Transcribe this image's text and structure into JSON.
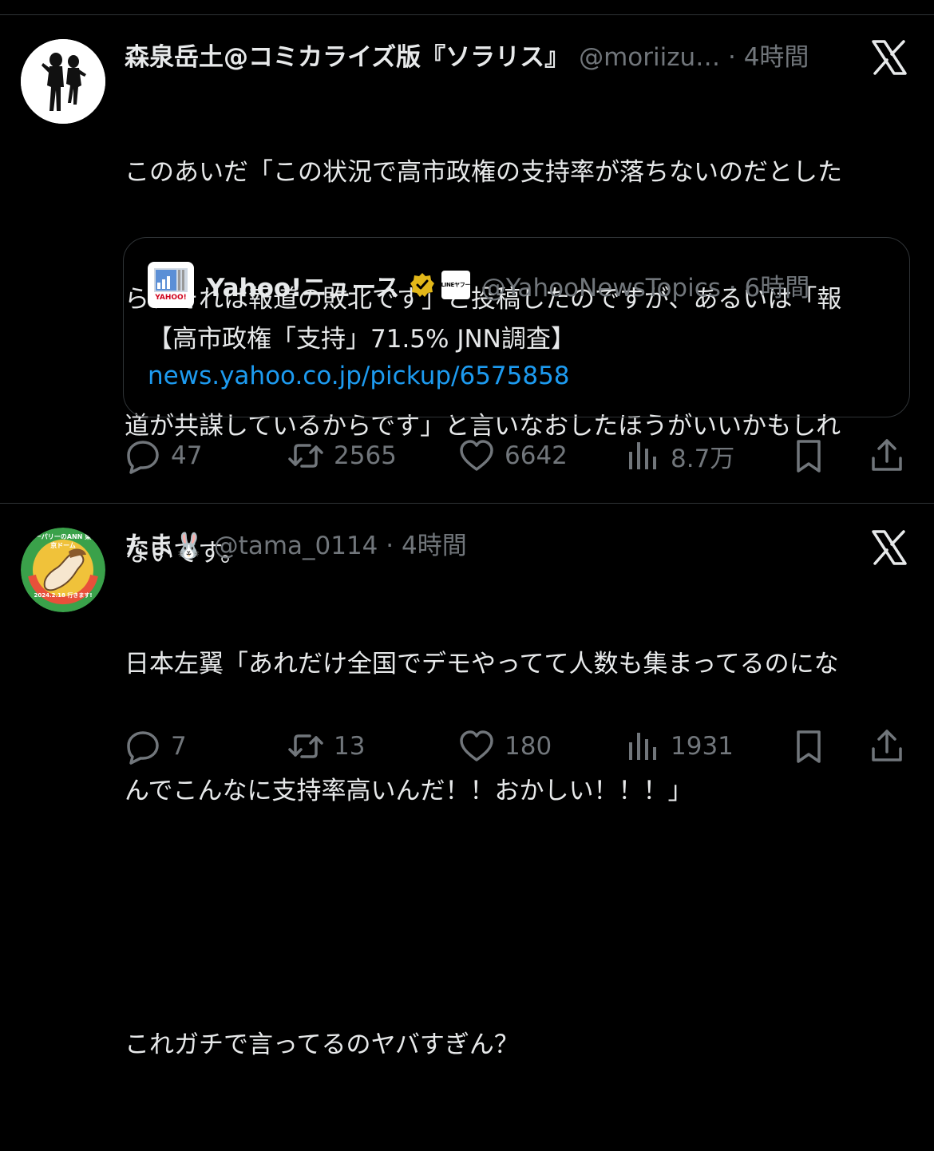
{
  "tweets": [
    {
      "display_name": "森泉岳土@コミカライズ版『ソラリス』",
      "handle_time": "@moriizu… · 4時間",
      "text": "このあいだ「この状況で高市政権の支持率が落ちないのだとしたら、それは報道の敗北です」と投稿したのですが、あるいは「報道が共謀しているからです」と言いなおしたほうがいいかもしれないです。",
      "text_lines": [
        "このあいだ「この状況で高市政権の支持率が落ちないのだとした",
        "ら、それは報道の敗北です」と投稿したのですが、あるいは「報",
        "道が共謀しているからです」と言いなおしたほうがいいかもしれ",
        "ないです。"
      ],
      "quote": {
        "display_name": "Yahoo!ニュース",
        "handle_time": "@YahooNewsTopics · 6時間",
        "text": "【高市政権「支持」71.5% JNN調査】",
        "link": "news.yahoo.co.jp/pickup/6575858",
        "logo_text": "YAHOO!",
        "badge_text": "LINEヤフー"
      },
      "stats": {
        "replies": "47",
        "retweets": "2565",
        "likes": "6642",
        "views": "8.7万"
      }
    },
    {
      "display_name": "たま🐰",
      "handle_time": "@tama_0114 · 4時間",
      "text_lines": [
        "日本左翼「あれだけ全国でデモやってて人数も集まってるのにな",
        "んでこんなに支持率高いんだ！！おかしい！！！」",
        "",
        "これガチで言ってるのヤバすぎん？"
      ],
      "avatar_text": "2024.2.18 行きます!",
      "avatar_arc_text": "ーパリーのANN 東京ドーム",
      "stats": {
        "replies": "7",
        "retweets": "13",
        "likes": "180",
        "views": "1931"
      }
    }
  ],
  "colors": {
    "background": "#000000",
    "text": "#e7e9ea",
    "muted": "#71767b",
    "link": "#1d9bf0",
    "divider": "#2f3336",
    "verified": "#e2b719"
  },
  "icons": [
    "reply-icon",
    "retweet-icon",
    "like-icon",
    "views-icon",
    "bookmark-icon",
    "share-icon",
    "x-logo-icon",
    "verified-icon"
  ]
}
